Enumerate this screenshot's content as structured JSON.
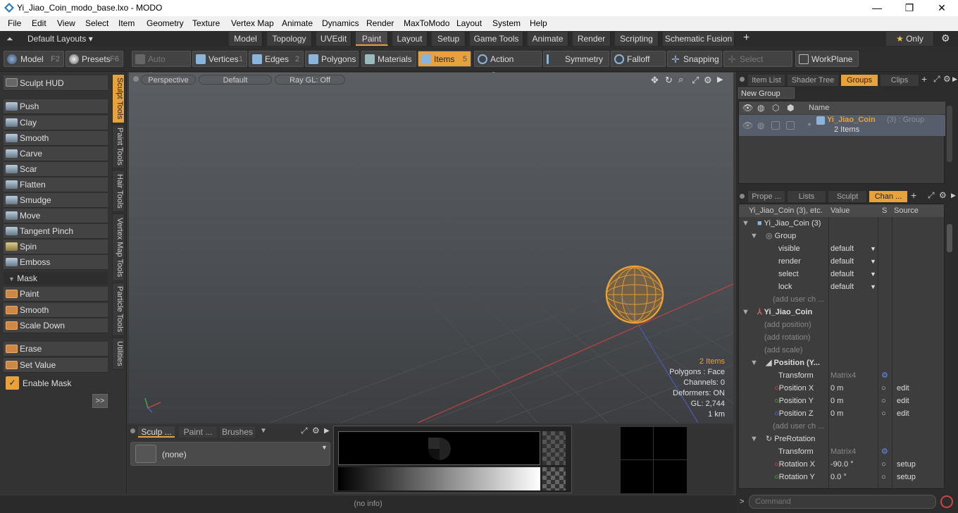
{
  "window": {
    "title": "Yi_Jiao_Coin_modo_base.lxo - MODO",
    "min": "—",
    "max": "❐",
    "close": "✕"
  },
  "menu": [
    "File",
    "Edit",
    "View",
    "Select",
    "Item",
    "Geometry",
    "Texture",
    "Vertex Map",
    "Animate",
    "Dynamics",
    "Render",
    "MaxToModo",
    "Layout",
    "System",
    "Help"
  ],
  "layoutbar": {
    "layouts_label": "Default Layouts ▾",
    "tabs": [
      "Model",
      "Topology",
      "UVEdit",
      "Paint",
      "Layout",
      "Setup",
      "Game Tools",
      "Animate",
      "Render",
      "Scripting",
      "Schematic Fusion"
    ],
    "active_tab": "Paint",
    "add": "+",
    "only": "Only",
    "star": "★",
    "gear": "⚙"
  },
  "toolbar": {
    "model": "Model",
    "model_key": "F2",
    "presets": "Presets",
    "presets_key": "F6",
    "auto_select": "Auto Select",
    "vertices": "Vertices",
    "vertices_key": "1",
    "edges": "Edges",
    "edges_key": "2",
    "polygons": "Polygons",
    "materials": "Materials",
    "items": "Items",
    "items_key": "5",
    "action_center": "Action Center",
    "symmetry": "Symmetry",
    "falloff": "Falloff",
    "snapping": "Snapping",
    "select_through": "Select Through",
    "workplane": "WorkPlane"
  },
  "sculpt": {
    "hud": "Sculpt HUD",
    "tools": [
      "Push",
      "Clay",
      "Smooth",
      "Carve",
      "Scar",
      "Flatten",
      "Smudge",
      "Move",
      "Tangent Pinch",
      "Spin",
      "Emboss"
    ],
    "mask_header": "Mask",
    "mask_tools": [
      "Paint",
      "Smooth",
      "Scale Down"
    ],
    "erase": "Erase",
    "set_value": "Set Value",
    "enable_mask": "Enable Mask",
    "expand": ">>",
    "vertical_tabs": [
      "Sculpt Tools",
      "Paint Tools",
      "Hair Tools",
      "Vertex Map Tools",
      "Particle Tools",
      "Utilities"
    ]
  },
  "viewport": {
    "view": "Perspective",
    "shading": "Default",
    "raygl": "Ray GL: Off",
    "stats": [
      "2 Items",
      "Polygons : Face",
      "Channels: 0",
      "Deformers: ON",
      "GL: 2,744",
      "1 km"
    ]
  },
  "bottom": {
    "tabs": [
      "Sculp ...",
      "Paint ...",
      "Brushes"
    ],
    "brush_value": "(none)"
  },
  "status": "(no info)",
  "groups": {
    "tabs": [
      "Item List",
      "Shader Tree",
      "Groups",
      "Clips"
    ],
    "active": "Groups",
    "new_group": "New Group",
    "name_header": "Name",
    "item_name": "Yi_Jiao_Coin",
    "item_suffix": "(3) : Group",
    "item_sub": "2 Items"
  },
  "channels": {
    "tabs": [
      "Prope ...",
      "Lists",
      "Sculpt",
      "Chan ..."
    ],
    "active": "Chan ...",
    "headers": [
      "Yi_Jiao_Coin (3), etc.",
      "Value",
      "S",
      "Source"
    ],
    "rows": [
      {
        "label": "Yi_Jiao_Coin (3)",
        "value": "",
        "source": ""
      },
      {
        "label": "Group",
        "value": "",
        "source": ""
      },
      {
        "label": "visible",
        "value": "default",
        "source": ""
      },
      {
        "label": "render",
        "value": "default",
        "source": ""
      },
      {
        "label": "select",
        "value": "default",
        "source": ""
      },
      {
        "label": "lock",
        "value": "default",
        "source": ""
      },
      {
        "label": "(add user ch ...",
        "value": "",
        "source": ""
      },
      {
        "label": "Yi_Jiao_Coin",
        "value": "",
        "source": ""
      },
      {
        "label": "(add position)",
        "value": "",
        "source": ""
      },
      {
        "label": "(add rotation)",
        "value": "",
        "source": ""
      },
      {
        "label": "(add scale)",
        "value": "",
        "source": ""
      },
      {
        "label": "Position (Y...",
        "value": "",
        "source": ""
      },
      {
        "label": "Transform",
        "value": "Matrix4",
        "source": ""
      },
      {
        "label": "Position X",
        "value": "0 m",
        "source": "edit"
      },
      {
        "label": "Position Y",
        "value": "0 m",
        "source": "edit"
      },
      {
        "label": "Position Z",
        "value": "0 m",
        "source": "edit"
      },
      {
        "label": "(add user ch ...",
        "value": "",
        "source": ""
      },
      {
        "label": "PreRotation",
        "value": "",
        "source": ""
      },
      {
        "label": "Transform",
        "value": "Matrix4",
        "source": ""
      },
      {
        "label": "Rotation X",
        "value": "-90.0 °",
        "source": "setup"
      },
      {
        "label": "Rotation Y",
        "value": "0.0 °",
        "source": "setup"
      }
    ],
    "command_placeholder": "Command"
  },
  "colors": {
    "accent": "#e8a23c",
    "panel": "#333333",
    "viewport": "#54585c"
  }
}
